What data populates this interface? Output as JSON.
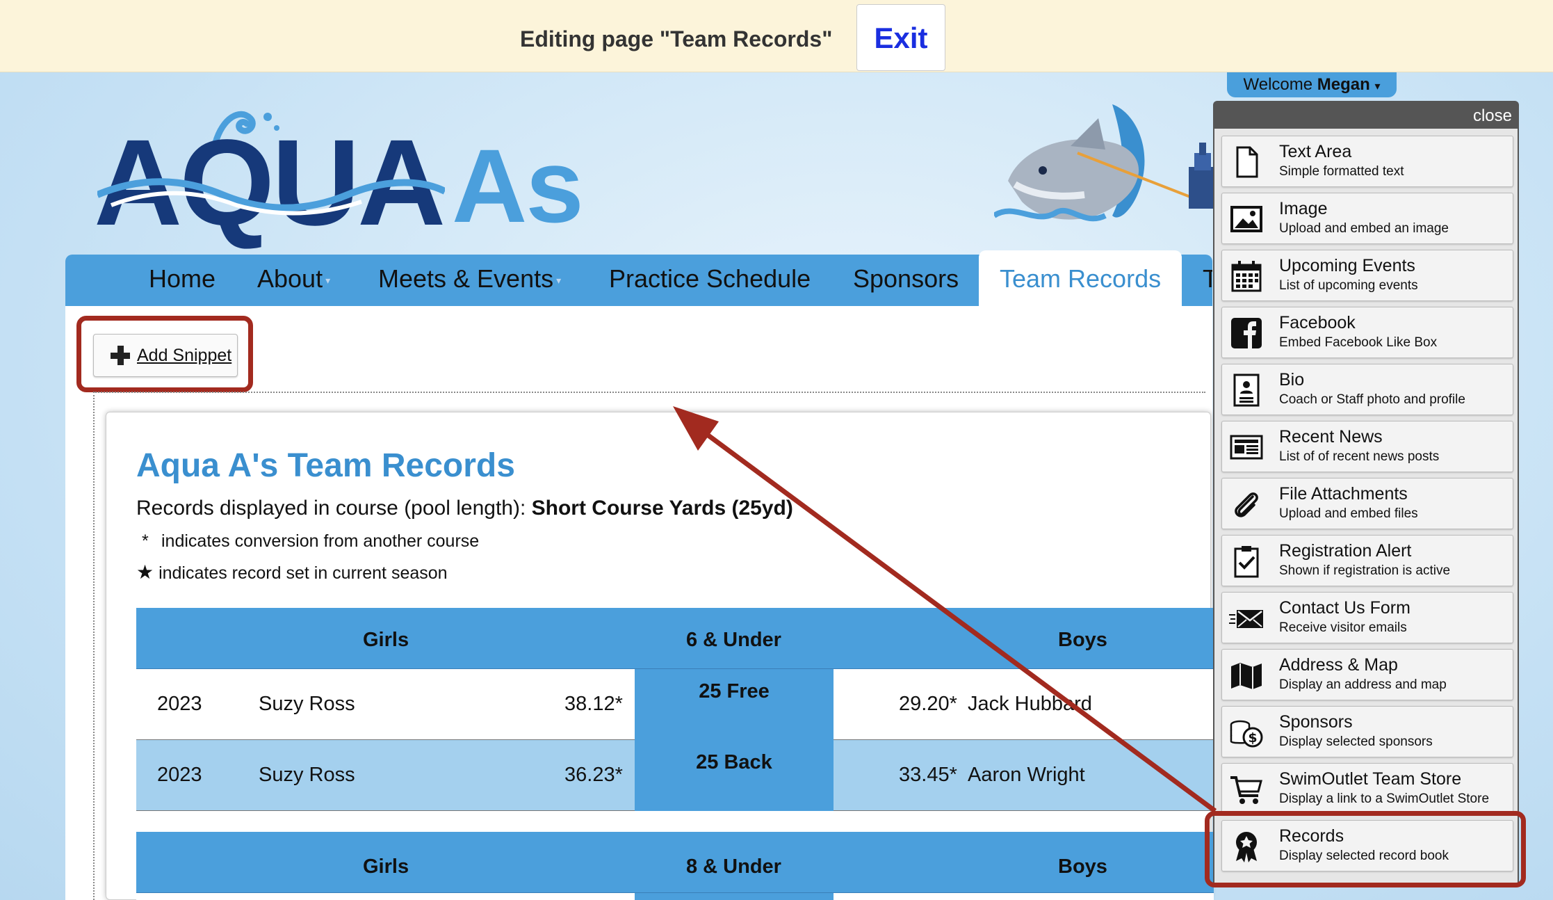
{
  "editbar": {
    "title": "Editing page \"Team Records\"",
    "exit_label": "Exit"
  },
  "welcome": {
    "prefix": "Welcome",
    "name": "Megan",
    "caret": "▾"
  },
  "logo": {
    "aqua": "AQUA",
    "as": "As"
  },
  "nav": {
    "items": [
      "Home",
      "About",
      "Meets & Events",
      "Practice Schedule",
      "Sponsors",
      "Team Records",
      "T"
    ],
    "caret": "▾",
    "active": "Team Records"
  },
  "add_snippet": {
    "label": "Add Snippet"
  },
  "records": {
    "title": "Aqua A's Team Records",
    "course_prefix": "Records displayed in course (pool length): ",
    "course_value": "Short Course Yards (25yd)",
    "note_conversion_symbol": "*",
    "note_conversion": "indicates conversion from another course",
    "note_current_symbol": "★",
    "note_current": "indicates record set in current season",
    "groups": [
      {
        "girls_label": "Girls",
        "age_group": "6 & Under",
        "boys_label": "Boys",
        "rows": [
          {
            "year": "2023",
            "girl": "Suzy Ross",
            "girl_time": "38.12*",
            "event": "25 Free",
            "boy_time": "29.20*",
            "boy": "Jack Hubbard"
          },
          {
            "year": "2023",
            "girl": "Suzy Ross",
            "girl_time": "36.23*",
            "event": "25 Back",
            "boy_time": "33.45*",
            "boy": "Aaron Wright"
          }
        ]
      },
      {
        "girls_label": "Girls",
        "age_group": "8 & Under",
        "boys_label": "Boys",
        "rows": []
      }
    ]
  },
  "panel": {
    "close_label": "close",
    "items": [
      {
        "name": "Text Area",
        "desc": "Simple formatted text",
        "icon": "document-icon"
      },
      {
        "name": "Image",
        "desc": "Upload and embed an image",
        "icon": "image-icon"
      },
      {
        "name": "Upcoming Events",
        "desc": "List of upcoming events",
        "icon": "calendar-icon"
      },
      {
        "name": "Facebook",
        "desc": "Embed Facebook Like Box",
        "icon": "facebook-icon"
      },
      {
        "name": "Bio",
        "desc": "Coach or Staff photo and profile",
        "icon": "id-card-icon"
      },
      {
        "name": "Recent News",
        "desc": "List of of recent news posts",
        "icon": "newspaper-icon"
      },
      {
        "name": "File Attachments",
        "desc": "Upload and embed files",
        "icon": "paperclip-icon"
      },
      {
        "name": "Registration Alert",
        "desc": "Shown if registration is active",
        "icon": "clipboard-check-icon"
      },
      {
        "name": "Contact Us Form",
        "desc": "Receive visitor emails",
        "icon": "envelope-icon"
      },
      {
        "name": "Address & Map",
        "desc": "Display an address and map",
        "icon": "map-icon"
      },
      {
        "name": "Sponsors",
        "desc": "Display selected sponsors",
        "icon": "coins-icon"
      },
      {
        "name": "SwimOutlet Team Store",
        "desc": "Display a link to a SwimOutlet Store",
        "icon": "cart-icon"
      },
      {
        "name": "Records",
        "desc": "Display selected record book",
        "icon": "award-icon"
      }
    ]
  },
  "colors": {
    "accent": "#4b9fdc",
    "title_blue": "#3a8fcf",
    "annotation_red": "#a22a1f",
    "editbar_bg": "#fcf4da",
    "exit_blue": "#1a2ee0"
  }
}
